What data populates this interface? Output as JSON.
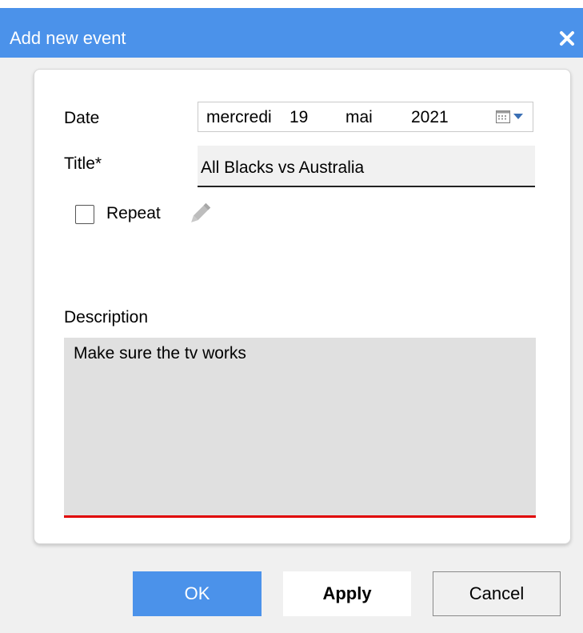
{
  "window": {
    "title": "Add new event",
    "accent_color": "#4b92ea"
  },
  "form": {
    "date": {
      "label": "Date",
      "weekday": "mercredi",
      "day": "19",
      "month": "mai",
      "year": "2021",
      "picker_icon": "calendar-icon"
    },
    "title": {
      "label": "Title*",
      "value": "All Blacks vs Australia"
    },
    "repeat": {
      "label": "Repeat",
      "checked": false,
      "edit_icon": "pencil-icon"
    },
    "description": {
      "label": "Description",
      "value": "Make sure the tv works",
      "error_color": "#e00000"
    }
  },
  "buttons": {
    "ok_label": "OK",
    "apply_label": "Apply",
    "cancel_label": "Cancel"
  }
}
